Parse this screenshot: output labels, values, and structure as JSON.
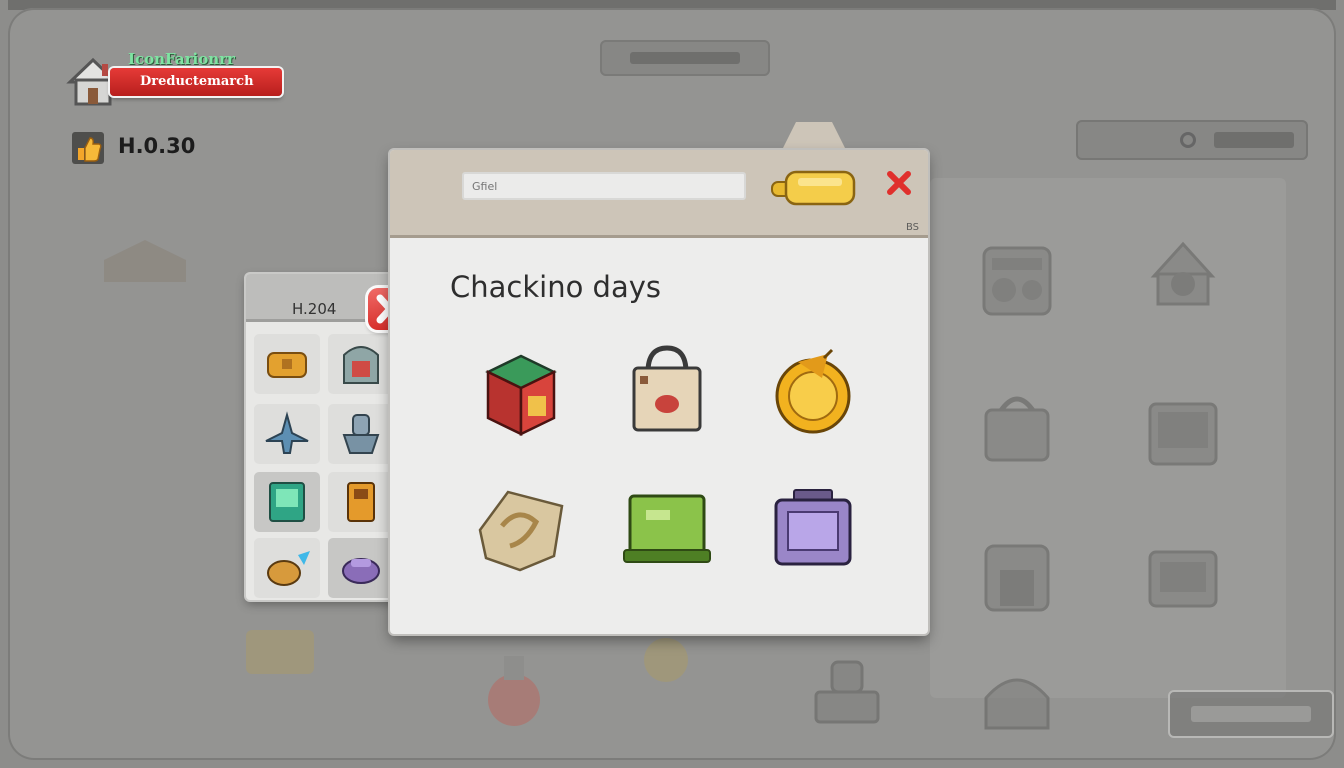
{
  "hud": {
    "game_title": "IconFarionrr",
    "banner_label": "Dreductemarch",
    "like_count": "H.0.30",
    "icons": {
      "home": "home-icon",
      "like": "thumbs-up-icon"
    }
  },
  "side_panel": {
    "value": "H.204",
    "items": [
      "treasure-chest-icon",
      "shrine-icon",
      "jet-icon",
      "robot-icon",
      "card-icon",
      "door-icon",
      "creature-icon",
      "purple-disc-icon"
    ],
    "close_icon": "close-icon"
  },
  "dialog": {
    "search_placeholder": "Gfiel",
    "action_icon": "golden-key-icon",
    "close_icon": "close-icon",
    "corner_label": "BS",
    "title": "Chackino days",
    "items": [
      {
        "icon": "red-crate-icon"
      },
      {
        "icon": "shopping-bag-icon"
      },
      {
        "icon": "golden-coin-icon"
      },
      {
        "icon": "treasure-map-icon"
      },
      {
        "icon": "green-chest-icon"
      },
      {
        "icon": "purple-monitor-icon"
      }
    ]
  },
  "colors": {
    "accent_red": "#d8302c",
    "title_green": "#7fe3a2",
    "dialog_header": "#cdc5b8",
    "background": "#8d8d8b"
  }
}
